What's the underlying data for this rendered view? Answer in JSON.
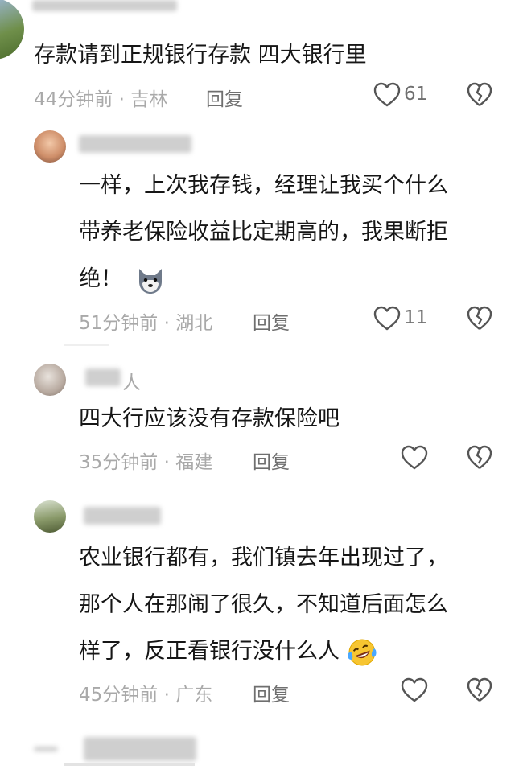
{
  "comments": [
    {
      "text_lines": [
        "存款请到正规银行存款 四大银行里"
      ],
      "time": "44分钟前",
      "location": "吉林",
      "reply_label": "回复",
      "likes": "61"
    },
    {
      "text_lines": [
        "一样，上次我存钱，经理让我买个什么",
        "带养老保险收益比定期高的，我果断拒",
        "绝！"
      ],
      "emoji": "dog-face-emoji",
      "time": "51分钟前",
      "location": "湖北",
      "reply_label": "回复",
      "likes": "11"
    },
    {
      "username_partial": "人",
      "text_lines": [
        "四大行应该没有存款保险吧"
      ],
      "time": "35分钟前",
      "location": "福建",
      "reply_label": "回复"
    },
    {
      "text_lines": [
        "农业银行都有，我们镇去年出现过了，",
        "那个人在那闹了很久，不知道后面怎么",
        "样了，反正看银行没什么人"
      ],
      "emoji": "laughing-tears-emoji",
      "time": "45分钟前",
      "location": "广东",
      "reply_label": "回复"
    }
  ],
  "meta_separator": "·",
  "icons": {
    "like": "heart-outline-icon",
    "dislike": "broken-heart-icon"
  },
  "colors": {
    "text": "#161616",
    "meta": "#a9a9a9",
    "action": "#6f6f6f"
  }
}
